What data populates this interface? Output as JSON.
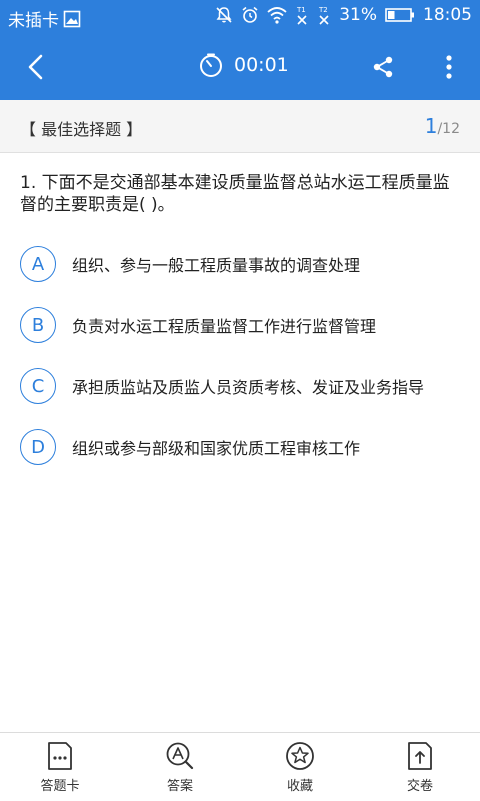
{
  "status_bar": {
    "carrier": "未插卡",
    "battery_percent": "31%",
    "time": "18:05",
    "signal_labels": [
      "T1",
      "T2"
    ],
    "battery_level": 0.31
  },
  "app_bar": {
    "timer": "00:01"
  },
  "question_header": {
    "type_label": "【 最佳选择题 】",
    "current": "1",
    "total": "/12"
  },
  "question": {
    "text": "1. 下面不是交通部基本建设质量监督总站水运工程质量监督的主要职责是(    )。",
    "options": [
      {
        "letter": "A",
        "text": "组织、参与一般工程质量事故的调查处理"
      },
      {
        "letter": "B",
        "text": "负责对水运工程质量监督工作进行监督管理"
      },
      {
        "letter": "C",
        "text": "承担质监站及质监人员资质考核、发证及业务指导"
      },
      {
        "letter": "D",
        "text": "组织或参与部级和国家优质工程审核工作"
      }
    ]
  },
  "bottom_bar": {
    "tabs": [
      {
        "label": "答题卡",
        "icon": "answer-sheet-icon"
      },
      {
        "label": "答案",
        "icon": "answer-search-icon"
      },
      {
        "label": "收藏",
        "icon": "star-icon"
      },
      {
        "label": "交卷",
        "icon": "submit-icon"
      }
    ]
  },
  "colors": {
    "primary": "#2d7fdc",
    "header_bg": "#f5f5f5"
  }
}
